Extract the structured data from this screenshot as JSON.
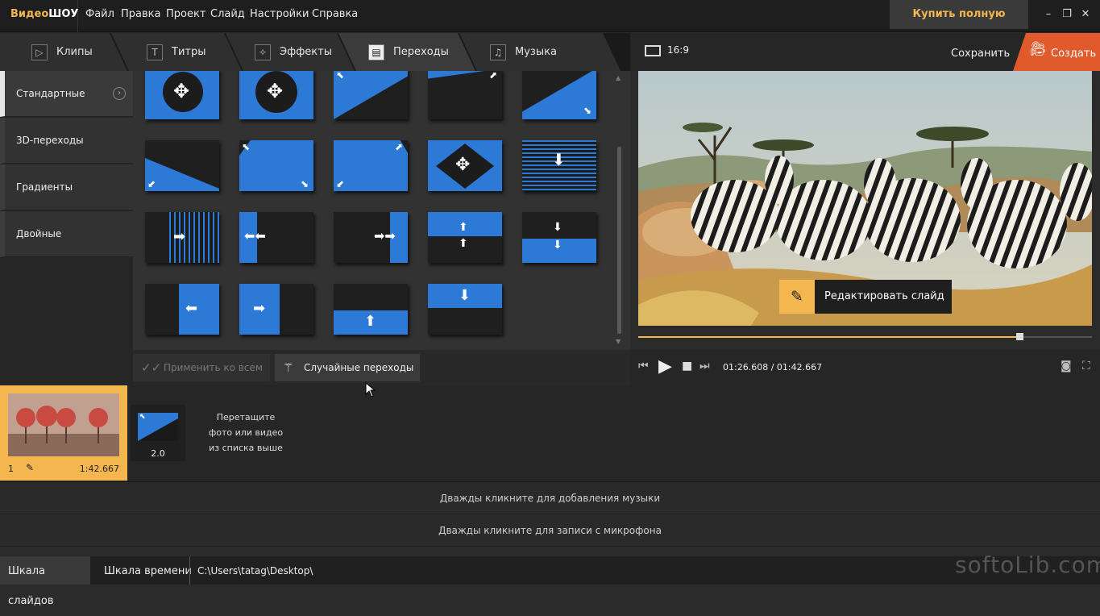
{
  "app": {
    "logo_part1": "Видео",
    "logo_part2": "ШОУ"
  },
  "menu": [
    "Файл",
    "Правка",
    "Проект",
    "Слайд",
    "Настройки",
    "Справка"
  ],
  "buy_button": "Купить полную версию",
  "window_controls": {
    "minimize": "minimize-icon",
    "restore": "restore-icon",
    "close": "close-icon"
  },
  "tabs": [
    {
      "label": "Клипы",
      "icon": "play-icon"
    },
    {
      "label": "Титры",
      "icon": "text-icon"
    },
    {
      "label": "Эффекты",
      "icon": "magic-wand-icon"
    },
    {
      "label": "Переходы",
      "icon": "clapperboard-icon",
      "active": true
    },
    {
      "label": "Музыка",
      "icon": "music-icon"
    }
  ],
  "categories": [
    {
      "label": "Стандартные",
      "active": true
    },
    {
      "label": "3D-переходы"
    },
    {
      "label": "Градиенты"
    },
    {
      "label": "Двойные"
    }
  ],
  "grid_buttons": {
    "apply_all": "Применить ко всем",
    "random": "Случайные переходы"
  },
  "preview": {
    "aspect": "16:9",
    "save": "Сохранить",
    "create": "Создать",
    "edit_slide": "Редактировать слайд",
    "time_current": "01:26.608",
    "time_total": "01:42.667",
    "progress": 0.84
  },
  "timeline": {
    "slide_number": "1",
    "slide_duration": "1:42.667",
    "transition_duration": "2.0",
    "drop_hint_1": "Перетащите",
    "drop_hint_2": "фото или видео",
    "drop_hint_3": "из списка выше",
    "music_track": "Дважды кликните для добавления музыки",
    "mic_track": "Дважды кликните для записи с микрофона"
  },
  "statusbar": {
    "slides": "Шкала слайдов",
    "timeline": "Шкала времени",
    "path": "C:\\Users\\tatag\\Desktop\\"
  },
  "watermark": "softoLib.com",
  "colors": {
    "accent": "#f4b64e",
    "create": "#e05a2b",
    "transition_blue": "#2c7ad6"
  }
}
